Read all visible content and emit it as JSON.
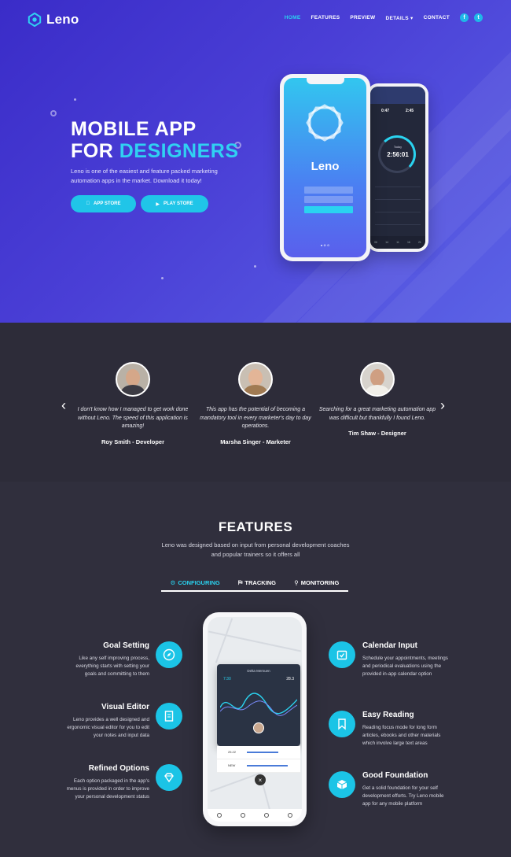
{
  "brand": {
    "name": "Leno"
  },
  "nav": {
    "items": [
      {
        "label": "HOME",
        "active": true
      },
      {
        "label": "FEATURES",
        "active": false
      },
      {
        "label": "PREVIEW",
        "active": false
      },
      {
        "label": "DETAILS",
        "active": false
      },
      {
        "label": "CONTACT",
        "active": false
      }
    ],
    "social": [
      "f",
      "t"
    ]
  },
  "hero": {
    "title_line1": "MOBILE APP",
    "title_for": "FOR",
    "title_accent": "DESIGNERS",
    "description": "Leno is one of the easiest and feature packed marketing automation apps in the market. Download it today!",
    "app_store_label": "APP STORE",
    "play_store_label": "PLAY STORE"
  },
  "phone_front": {
    "app_name": "Leno",
    "field1": "",
    "field2": "",
    "button": "",
    "footer": "● ⊘ ⊙"
  },
  "phone_back": {
    "stat1": "0:47",
    "stat2": "2:45",
    "label": "Today",
    "time": "2:56:01",
    "rows": [
      "",
      "",
      "",
      "",
      ""
    ],
    "bottom": [
      "06",
      "14",
      "11",
      "16",
      "21"
    ]
  },
  "testimonials": [
    {
      "quote": "I don't know how I managed to get work done without Leno. The speed of this application is amazing!",
      "author": "Roy Smith - Developer"
    },
    {
      "quote": "This app has the potential of becoming a mandatory tool in every marketer's day to day operations.",
      "author": "Marsha Singer - Marketer"
    },
    {
      "quote": "Searching for a great marketing automation app was difficult but thankfully I found Leno.",
      "author": "Tim Shaw - Designer"
    }
  ],
  "features": {
    "title": "FEATURES",
    "subtitle": "Leno was designed based on input from personal development coaches and popular trainers so it offers all",
    "tabs": [
      {
        "icon": "⚙",
        "label": "CONFIGURING",
        "active": true
      },
      {
        "icon": "⛿",
        "label": "TRACKING",
        "active": false
      },
      {
        "icon": "⚲",
        "label": "MONITORING",
        "active": false
      }
    ],
    "left": [
      {
        "title": "Goal Setting",
        "text": "Like any self improving process, everything starts with setting your goals and committing to them"
      },
      {
        "title": "Visual Editor",
        "text": "Leno provides a well designed and ergonomic visual editor for you to edit your notes and input data"
      },
      {
        "title": "Refined Options",
        "text": "Each option packaged in the app's menus is provided in order to improve your personal development status"
      }
    ],
    "right": [
      {
        "title": "Calendar Input",
        "text": "Schedule your appointments, meetings and periodical evaluations using the provided in-app calendar option"
      },
      {
        "title": "Easy Reading",
        "text": "Reading focus mode for long form articles, ebooks and other materials which involve large text areas"
      },
      {
        "title": "Good Foundation",
        "text": "Get a solid foundation for your self development efforts. Try Leno mobile app for any mobile platform"
      }
    ]
  },
  "phone_mid": {
    "card_name": "Delta Memuen",
    "card_left": "7:30",
    "card_right": "28.3",
    "row1": "25.22",
    "row2": "NEW"
  },
  "colors": {
    "accent": "#2ad3f0",
    "hero_bg": "#3a2cc8",
    "dark_bg": "#2d2c39"
  }
}
